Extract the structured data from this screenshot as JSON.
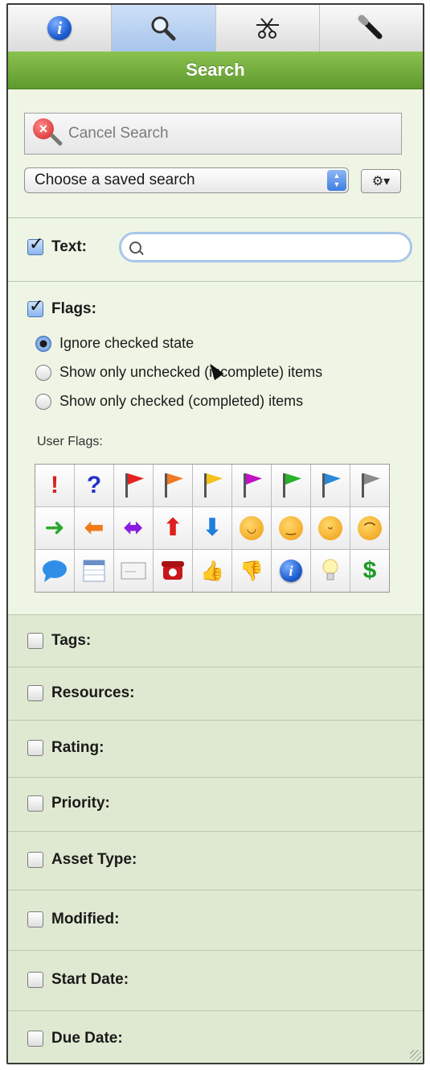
{
  "toolbar": {
    "tabs": [
      {
        "icon": "info-icon",
        "active": false
      },
      {
        "icon": "search-icon",
        "active": true
      },
      {
        "icon": "scissors-icon",
        "active": false
      },
      {
        "icon": "flashlight-icon",
        "active": false
      }
    ]
  },
  "header": {
    "title": "Search"
  },
  "search": {
    "cancel_label": "Cancel Search",
    "saved_search_value": "Choose a saved search",
    "gear_icon": "gear-icon"
  },
  "text_filter": {
    "label": "Text:",
    "checked": true,
    "value": ""
  },
  "flags_filter": {
    "label": "Flags:",
    "checked": true,
    "options": [
      {
        "label": "Ignore checked state",
        "selected": true
      },
      {
        "label": "Show only unchecked (incomplete) items",
        "selected": false
      },
      {
        "label": "Show only checked (completed) items",
        "selected": false
      }
    ],
    "user_flags_label": "User Flags:",
    "user_flags": [
      "exclamation",
      "question",
      "red-flag",
      "orange-flag",
      "yellow-flag",
      "purple-flag",
      "green-flag",
      "blue-flag",
      "gray-flag",
      "green-arrow-right",
      "orange-arrow-left",
      "purple-arrow-both",
      "red-arrow-up",
      "blue-arrow-down",
      "smiley-happy",
      "smiley-grin",
      "smiley-wink",
      "smiley-sad",
      "speech-bubble",
      "calendar",
      "envelope",
      "telephone",
      "thumbs-up",
      "thumbs-down",
      "info-circle",
      "light-bulb",
      "dollar-sign"
    ]
  },
  "sections": [
    {
      "label": "Tags:",
      "checked": false
    },
    {
      "label": "Resources:",
      "checked": false
    },
    {
      "label": "Rating:",
      "checked": false
    },
    {
      "label": "Priority:",
      "checked": false
    },
    {
      "label": "Asset Type:",
      "checked": false
    },
    {
      "label": "Modified:",
      "checked": false
    },
    {
      "label": "Start Date:",
      "checked": false
    },
    {
      "label": "Due Date:",
      "checked": false
    }
  ],
  "colors": {
    "header_green": "#6fab38",
    "panel_bg": "#eef5e4",
    "section_bg": "#dfe9d1",
    "selected_tab": "#a7c5ec"
  }
}
